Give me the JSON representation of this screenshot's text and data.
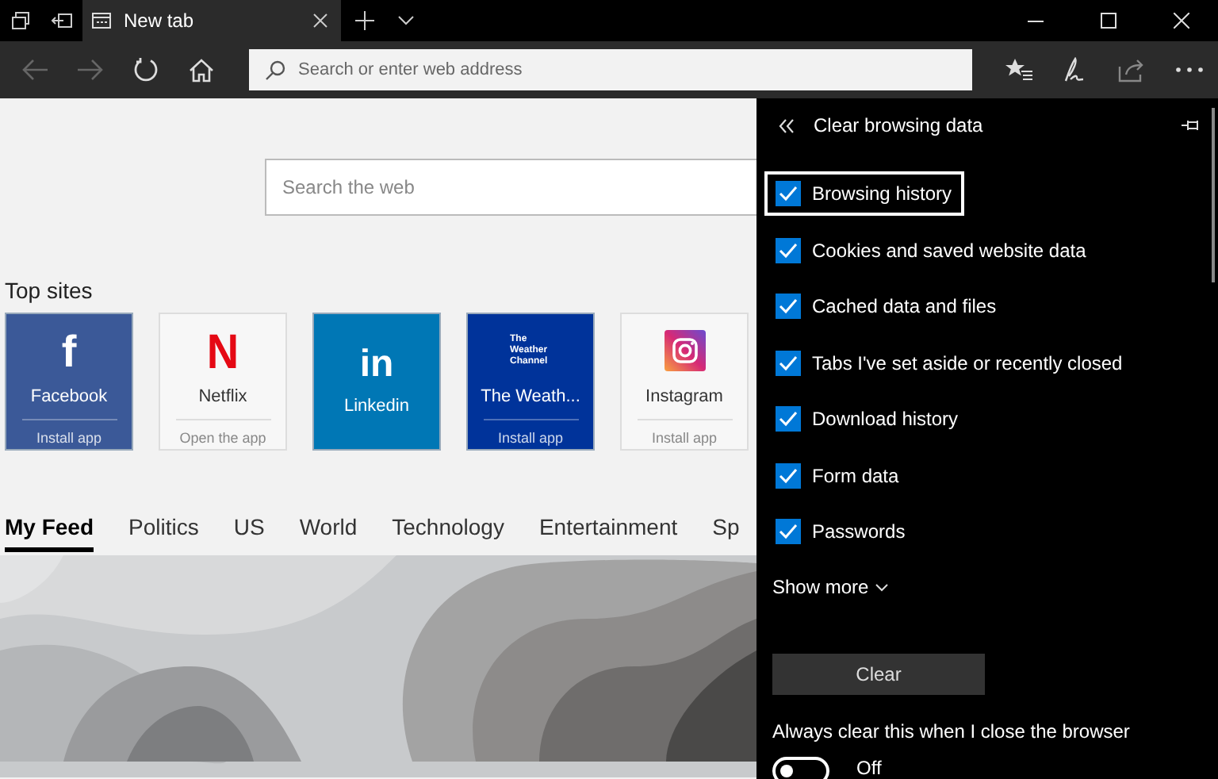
{
  "tab": {
    "title": "New tab",
    "selected": true
  },
  "address_bar": {
    "placeholder": "Search or enter web address"
  },
  "search": {
    "placeholder": "Search the web"
  },
  "top_sites": {
    "heading": "Top sites",
    "tiles": [
      {
        "kind": "facebook",
        "logo": "f",
        "name": "Facebook",
        "action": "Install app",
        "color": "#3b5998"
      },
      {
        "kind": "netflix",
        "logo": "N",
        "name": "Netflix",
        "action": "Open the app",
        "color": "#f7f7f7"
      },
      {
        "kind": "linkedin",
        "logo": "in",
        "name": "Linkedin",
        "color": "#0077b5"
      },
      {
        "kind": "weather",
        "logo": "The Weather Channel",
        "name": "The Weath...",
        "action": "Install app",
        "color": "#00339a"
      },
      {
        "kind": "instagram",
        "name": "Instagram",
        "action": "Install app",
        "color": "#f7f7f7"
      }
    ]
  },
  "feed_tabs": [
    {
      "label": "My Feed",
      "selected": true
    },
    {
      "label": "Politics",
      "selected": false
    },
    {
      "label": "US",
      "selected": false
    },
    {
      "label": "World",
      "selected": false
    },
    {
      "label": "Technology",
      "selected": false
    },
    {
      "label": "Entertainment",
      "selected": false
    },
    {
      "label": "Sp",
      "selected": false
    }
  ],
  "panel": {
    "title": "Clear browsing data",
    "options": [
      {
        "label": "Browsing history",
        "checked": true,
        "focused": true
      },
      {
        "label": "Cookies and saved website data",
        "checked": true,
        "focused": false
      },
      {
        "label": "Cached data and files",
        "checked": true,
        "focused": false
      },
      {
        "label": "Tabs I've set aside or recently closed",
        "checked": true,
        "focused": false
      },
      {
        "label": "Download history",
        "checked": true,
        "focused": false
      },
      {
        "label": "Form data",
        "checked": true,
        "focused": false
      },
      {
        "label": "Passwords",
        "checked": true,
        "focused": false
      }
    ],
    "show_more": "Show more",
    "clear_button": "Clear",
    "always_clear": {
      "label": "Always clear this when I close the browser",
      "on": false,
      "state_text": "Off"
    }
  }
}
